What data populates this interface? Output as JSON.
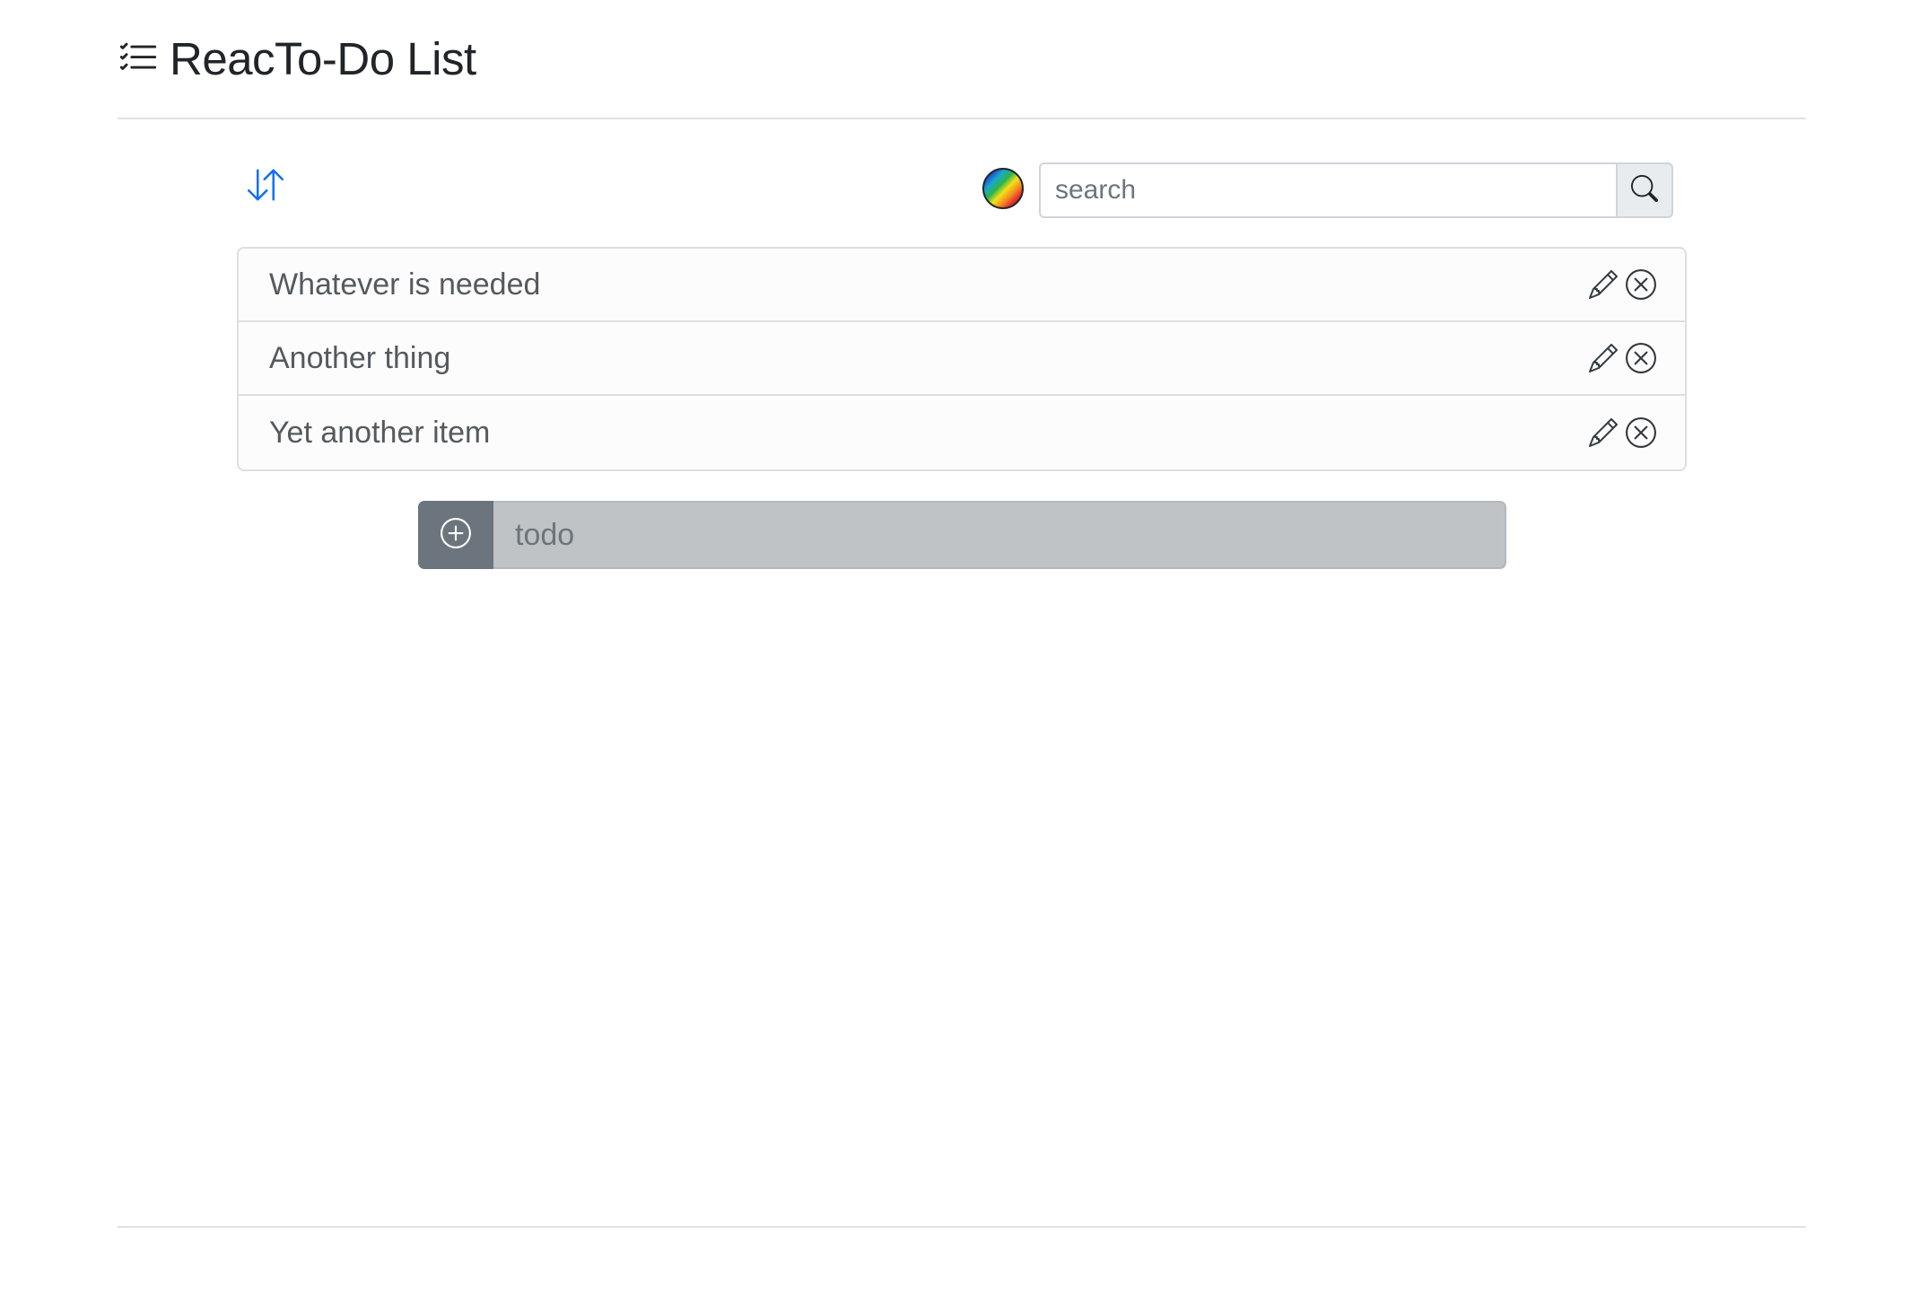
{
  "header": {
    "title": "ReacTo-Do List",
    "icon": "list-check-icon"
  },
  "toolbar": {
    "sort_icon": "sort-arrows-icon",
    "theme_icon": "rainbow-theme-icon",
    "search": {
      "placeholder": "search",
      "value": "",
      "button_icon": "search-icon"
    }
  },
  "todos": [
    {
      "text": "Whatever is needed"
    },
    {
      "text": "Another thing"
    },
    {
      "text": "Yet another item"
    }
  ],
  "add_todo": {
    "button_icon": "plus-circle-icon",
    "placeholder": "todo",
    "value": ""
  },
  "colors": {
    "accent": "#0d6efd",
    "secondary": "#6c757d",
    "border": "#dee2e6"
  }
}
